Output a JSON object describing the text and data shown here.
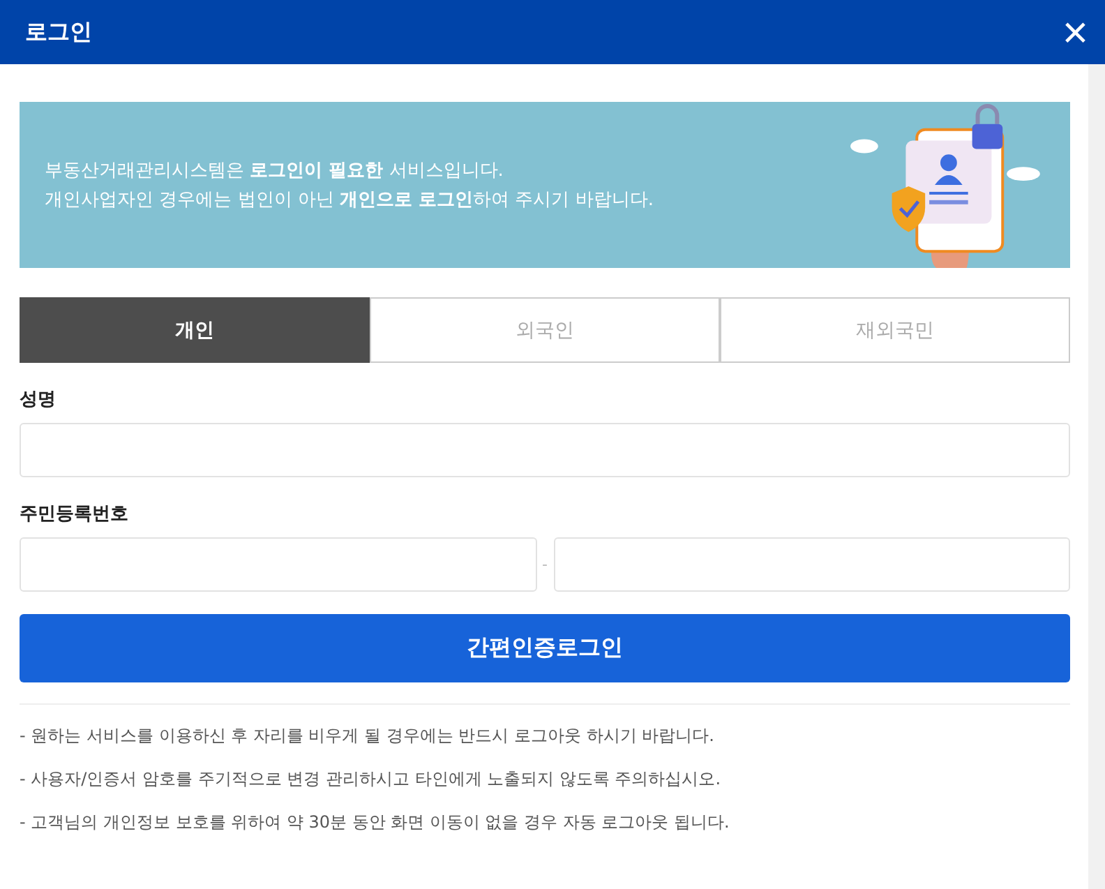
{
  "window": {
    "title": "로그인",
    "close": "×"
  },
  "banner": {
    "lines": [
      "부동산거래관리시스템은 **로그인이 필요한** 서비스입니다.",
      "개인사업자인 경우에는 법인이 아닌 **개인으로 로그인**하여 주시기 바랍니다."
    ]
  },
  "tabs": [
    {
      "label": "개인",
      "selected": true
    },
    {
      "label": "외국인",
      "selected": false
    },
    {
      "label": "재외국민",
      "selected": false
    }
  ],
  "name_field": {
    "label": "성명"
  },
  "rrn_field": {
    "label": "주민등록번호",
    "separator": "-"
  },
  "login_button": "간편인증로그인",
  "notes": [
    "- 원하는 서비스를 이용하신 후 자리를 비우게 될 경우에는 반드시 로그아웃 하시기 바랍니다.",
    "- 사용자/인증서 암호를 주기적으로 변경 관리하시고 타인에게 노출되지 않도록 주의하십시오.",
    "- 고객님의 개인정보 보호를 위하여 약 30분 동안 화면 이동이 없을 경우 자동 로그아웃 됩니다."
  ]
}
